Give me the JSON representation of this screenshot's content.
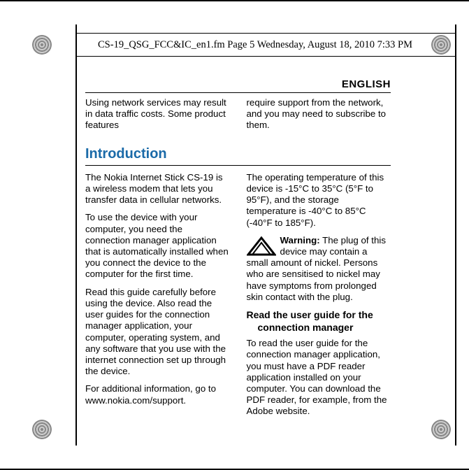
{
  "pageinfo": "CS-19_QSG_FCC&IC_en1.fm  Page 5  Wednesday, August 18, 2010  7:33 PM",
  "header": {
    "language": "ENGLISH"
  },
  "preamble": {
    "col1": "Using network services may result in data traffic costs. Some product features",
    "col2": "require support from the network, and you may need to subscribe to them."
  },
  "section": {
    "title": "Introduction"
  },
  "body": {
    "col1": {
      "p1": "The Nokia Internet Stick CS-19 is a wireless modem that lets you transfer data in cellular networks.",
      "p2": "To use the device with your computer, you need the connection manager application that is automatically installed when you connect the device to the computer for the first time.",
      "p3": "Read this guide carefully before using the device. Also read the user guides for the connection manager application, your computer, operating system, and any software that you use with the internet connection set up through the device.",
      "p4": "For additional information, go to www.nokia.com/support."
    },
    "col2": {
      "p1": "The operating temperature of this device is -15°C to 35°C (5°F to 95°F), and the storage temperature is -40°C to 85°C (-40°F to 185°F).",
      "warning_label": "Warning:",
      "warning_text": " The plug of this device may contain a small amount of nickel. Persons who are sensitised to nickel may have symptoms from prolonged skin contact with the plug.",
      "subheading": "Read the user guide for the connection manager",
      "p3": "To read the user guide for the connection manager application, you must have a PDF reader application installed on your computer. You can download the PDF reader, for example, from the Adobe website."
    }
  },
  "icons": {
    "warning": "warning-triangle-icon"
  }
}
